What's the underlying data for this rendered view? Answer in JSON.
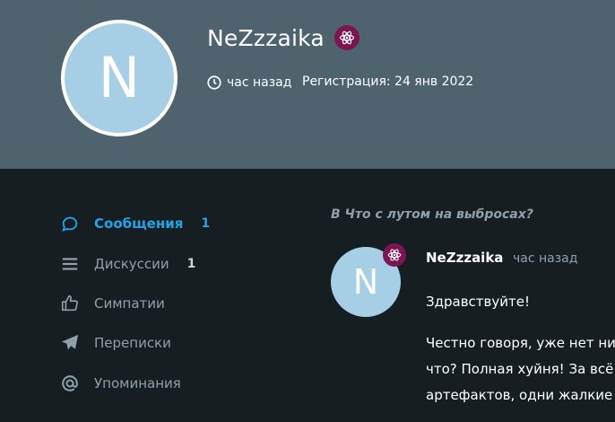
{
  "profile": {
    "avatar_letter": "N",
    "username": "NeZzzaika",
    "last_seen": "час назад",
    "registration": "Регистрация: 24 янв 2022",
    "badge_icon": "atom-icon",
    "colors": {
      "header_bg": "#4e636e",
      "badge_bg": "#7a1753",
      "avatar_bg": "#a6cfe6"
    }
  },
  "nav": {
    "items": [
      {
        "label": "Сообщения",
        "count": "1",
        "icon": "speech-bubble-icon",
        "active": true
      },
      {
        "label": "Дискуссии",
        "count": "1",
        "icon": "list-icon",
        "active": false
      },
      {
        "label": "Симпатии",
        "count": "",
        "icon": "thumbs-up-icon",
        "active": false
      },
      {
        "label": "Переписки",
        "count": "",
        "icon": "paper-plane-icon",
        "active": false
      },
      {
        "label": "Упоминания",
        "count": "",
        "icon": "at-icon",
        "active": false
      }
    ],
    "colors": {
      "active": "#21a4e8",
      "inactive": "#8ea0aa"
    }
  },
  "post": {
    "context": "В Что с лутом на выбросах?",
    "avatar_letter": "N",
    "author": "NeZzzaika",
    "time": "час назад",
    "lines": [
      "Здравствуйте!",
      "Честно говоря, уже нет ни",
      "что? Полная хуйня! За всё",
      "артефактов, одни жалкие"
    ]
  }
}
